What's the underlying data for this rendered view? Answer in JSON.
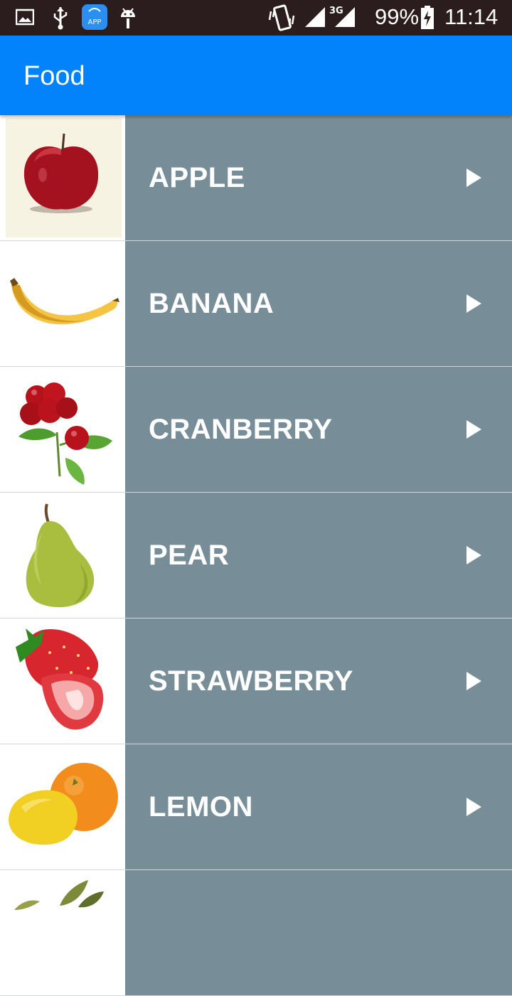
{
  "status_bar": {
    "battery_percent": "99%",
    "time": "11:14",
    "network": "3G",
    "icons": [
      "image-icon",
      "usb-icon",
      "app-store-icon",
      "android-icon",
      "vibrate-icon",
      "signal-icon",
      "signal-3g-icon",
      "battery-charging-icon"
    ]
  },
  "app_bar": {
    "title": "Food"
  },
  "items": [
    {
      "label": "APPLE",
      "icon": "apple-icon"
    },
    {
      "label": "BANANA",
      "icon": "banana-icon"
    },
    {
      "label": "CRANBERRY",
      "icon": "cranberry-icon"
    },
    {
      "label": "PEAR",
      "icon": "pear-icon"
    },
    {
      "label": "STRAWBERRY",
      "icon": "strawberry-icon"
    },
    {
      "label": "LEMON",
      "icon": "lemon-icon"
    },
    {
      "label": "",
      "icon": "leaves-icon"
    }
  ],
  "colors": {
    "app_bar": "#0283fb",
    "row_panel": "#778e99",
    "status_bar": "#2b1d1d"
  }
}
